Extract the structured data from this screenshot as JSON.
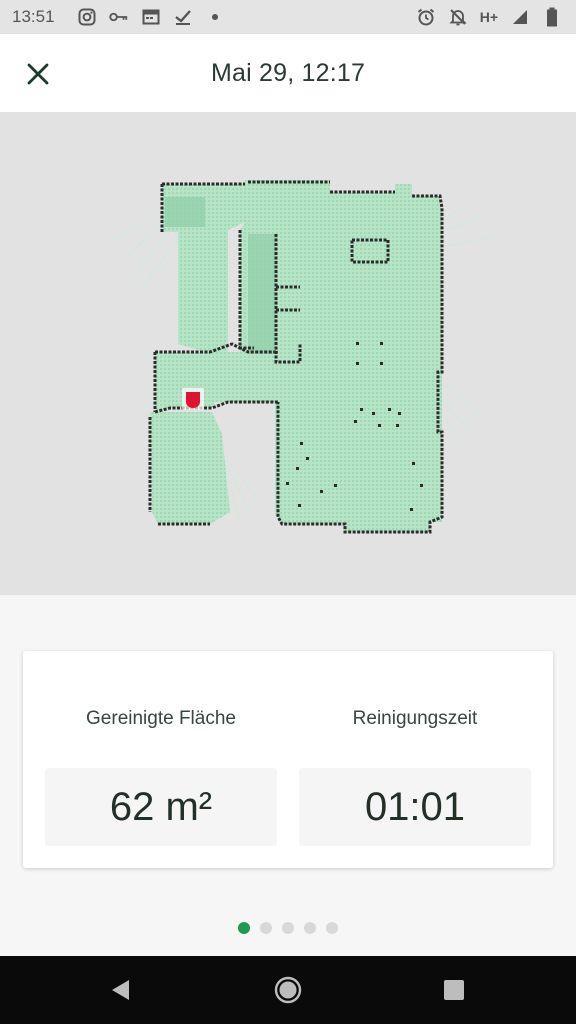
{
  "status_bar": {
    "time": "13:51",
    "left_icons": [
      "instagram-icon",
      "key-icon",
      "calendar-icon",
      "check-icon",
      "dot-icon"
    ],
    "right_icons": [
      "alarm-icon",
      "notifications-off-icon",
      "network-type-text",
      "signal-icon",
      "battery-icon"
    ],
    "network_type": "H+"
  },
  "header": {
    "title": "Mai 29, 12:17",
    "close_icon": "close-icon"
  },
  "map": {
    "floor_color": "#b7e4c7",
    "wall_color": "#2a2a2a",
    "robot_color": "#e1132e",
    "background": "#e2e2e2"
  },
  "stats": {
    "area": {
      "label": "Gereinigte Fläche",
      "value": "62 m²"
    },
    "time": {
      "label": "Reinigungszeit",
      "value": "01:01"
    }
  },
  "pager": {
    "count": 5,
    "active_index": 0,
    "active_color": "#1f9a4e"
  },
  "nav_bar": {
    "back_icon": "back-icon",
    "home_icon": "home-icon",
    "recents_icon": "recents-icon"
  }
}
